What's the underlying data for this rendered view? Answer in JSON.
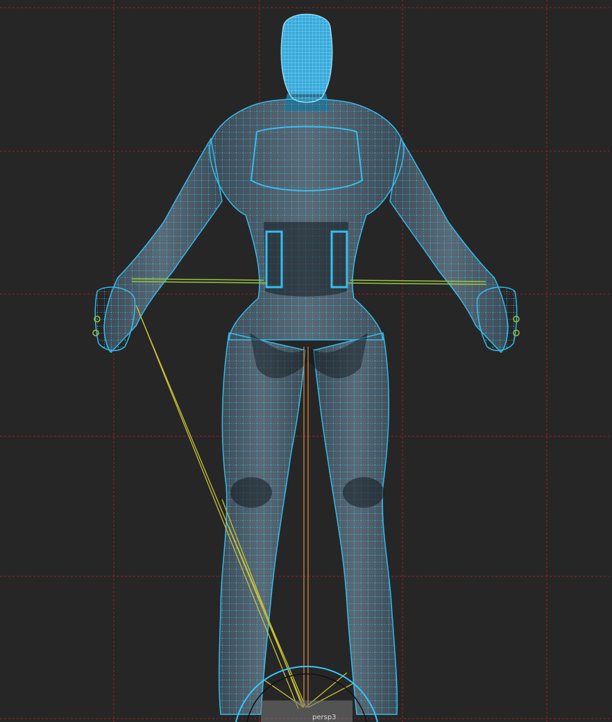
{
  "viewport": {
    "camera_label": "persp3",
    "background_color": "#262626",
    "grid_color": "#a01e28",
    "wireframe_color": "#35c9ff",
    "mesh_shade_color": "#4a5a66",
    "joint_color": "#9cc63a",
    "ik_line_color": "#c8c23a",
    "camera_line_color": "#e08a3a"
  }
}
